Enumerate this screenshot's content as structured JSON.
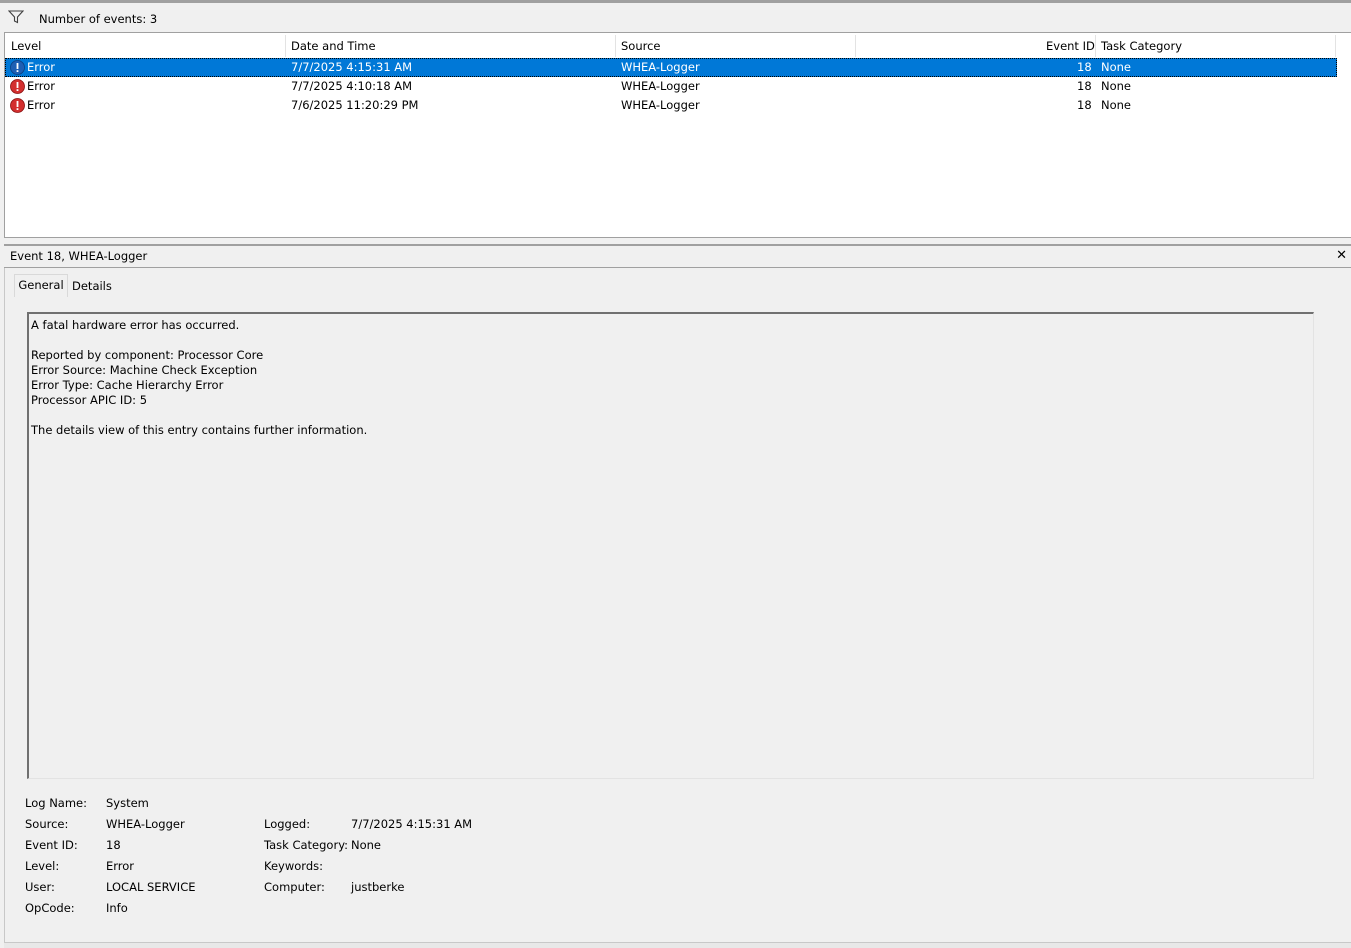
{
  "filter": {
    "text": "Number of events: 3"
  },
  "list": {
    "columns": [
      "Level",
      "Date and Time",
      "Source",
      "Event ID",
      "Task Category"
    ],
    "rows": [
      {
        "level": "Error",
        "datetime": "7/7/2025 4:15:31 AM",
        "source": "WHEA-Logger",
        "event_id": "18",
        "task_category": "None",
        "selected": true
      },
      {
        "level": "Error",
        "datetime": "7/7/2025 4:10:18 AM",
        "source": "WHEA-Logger",
        "event_id": "18",
        "task_category": "None",
        "selected": false
      },
      {
        "level": "Error",
        "datetime": "7/6/2025 11:20:29 PM",
        "source": "WHEA-Logger",
        "event_id": "18",
        "task_category": "None",
        "selected": false
      }
    ]
  },
  "detail": {
    "title": "Event 18, WHEA-Logger",
    "tabs": [
      "General",
      "Details"
    ],
    "description": [
      "A fatal hardware error has occurred.",
      "",
      "Reported by component: Processor Core",
      "Error Source: Machine Check Exception",
      "Error Type: Cache Hierarchy Error",
      "Processor APIC ID: 5",
      "",
      "The details view of this entry contains further information."
    ],
    "properties": {
      "log_name_label": "Log Name:",
      "log_name": "System",
      "source_label": "Source:",
      "source": "WHEA-Logger",
      "event_id_label": "Event ID:",
      "event_id": "18",
      "level_label": "Level:",
      "level": "Error",
      "user_label": "User:",
      "user": "LOCAL SERVICE",
      "opcode_label": "OpCode:",
      "opcode": "Info",
      "logged_label": "Logged:",
      "logged": "7/7/2025 4:15:31 AM",
      "task_category_label": "Task Category:",
      "task_category": "None",
      "keywords_label": "Keywords:",
      "keywords": "",
      "computer_label": "Computer:",
      "computer": "justberke"
    }
  },
  "colors": {
    "selection": "#0078d7",
    "error_icon": "#d32f2f",
    "info_icon": "#1e5fb4"
  }
}
